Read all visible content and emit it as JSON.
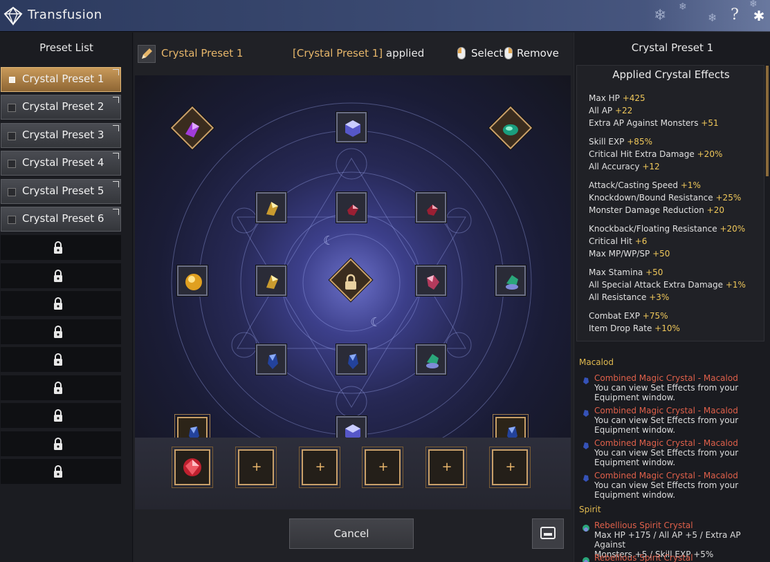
{
  "window": {
    "title": "Transfusion",
    "icons": [
      "diamond-logo-icon",
      "help-icon",
      "close-icon"
    ]
  },
  "left": {
    "heading": "Preset List",
    "presets": [
      {
        "label": "Crystal Preset 1",
        "active": true
      },
      {
        "label": "Crystal Preset 2",
        "active": false
      },
      {
        "label": "Crystal Preset 3",
        "active": false
      },
      {
        "label": "Crystal Preset 4",
        "active": false
      },
      {
        "label": "Crystal Preset 5",
        "active": false
      },
      {
        "label": "Crystal Preset 6",
        "active": false
      }
    ],
    "locked_slots": 9
  },
  "center": {
    "preset_name": "Crystal Preset 1",
    "applied_name": "[Crystal Preset 1]",
    "applied_suffix": " applied",
    "select_label": "Select",
    "remove_label": "Remove",
    "cancel_label": "Cancel",
    "bottom_slots": [
      "ruby",
      "empty",
      "empty",
      "empty",
      "empty",
      "empty"
    ]
  },
  "right": {
    "heading": "Crystal Preset 1",
    "effects_title": "Applied Crystal Effects",
    "effect_groups": [
      [
        {
          "name": "Max HP",
          "value": "+425"
        },
        {
          "name": "All AP",
          "value": "+22"
        },
        {
          "name": "Extra AP Against Monsters",
          "value": "+51"
        }
      ],
      [
        {
          "name": "Skill EXP",
          "value": "+85%"
        },
        {
          "name": "Critical Hit Extra Damage",
          "value": "+20%"
        },
        {
          "name": "All Accuracy",
          "value": "+12"
        }
      ],
      [
        {
          "name": "Attack/Casting Speed",
          "value": "+1%"
        },
        {
          "name": "Knockdown/Bound Resistance",
          "value": "+25%"
        },
        {
          "name": "Monster Damage Reduction",
          "value": "+20"
        }
      ],
      [
        {
          "name": "Knockback/Floating Resistance",
          "value": "+20%"
        },
        {
          "name": "Critical Hit",
          "value": "+6"
        },
        {
          "name": "Max MP/WP/SP",
          "value": "+50"
        }
      ],
      [
        {
          "name": "Max Stamina",
          "value": "+50"
        },
        {
          "name": "All Special Attack Extra Damage",
          "value": "+1%"
        },
        {
          "name": "All Resistance",
          "value": "+3%"
        }
      ],
      [
        {
          "name": "Combat EXP",
          "value": "+75%"
        },
        {
          "name": "Item Drop Rate",
          "value": "+10%"
        }
      ]
    ],
    "sets": [
      {
        "label": "Macalod",
        "items": [
          {
            "name": "Combined Magic Crystal - Macalod",
            "desc1": "You can view Set Effects from your",
            "desc2": "Equipment window."
          },
          {
            "name": "Combined Magic Crystal - Macalod",
            "desc1": "You can view Set Effects from your",
            "desc2": "Equipment window."
          },
          {
            "name": "Combined Magic Crystal - Macalod",
            "desc1": "You can view Set Effects from your",
            "desc2": "Equipment window."
          },
          {
            "name": "Combined Magic Crystal - Macalod",
            "desc1": "You can view Set Effects from your",
            "desc2": "Equipment window."
          }
        ]
      },
      {
        "label": "Spirit",
        "items": [
          {
            "name": "Rebellious Spirit Crystal",
            "desc1": "Max HP +175 / All AP +5 / Extra AP Against",
            "desc2": "Monsters +5 / Skill EXP +5%"
          },
          {
            "name": "Rebellious Spirit Crystal",
            "desc1": "",
            "desc2": ""
          }
        ]
      }
    ]
  },
  "colors": {
    "accent_gold": "#e6b66a",
    "value_gold": "#f0c85a",
    "set_red": "#e0604a",
    "active_preset": "#c99a5a"
  }
}
